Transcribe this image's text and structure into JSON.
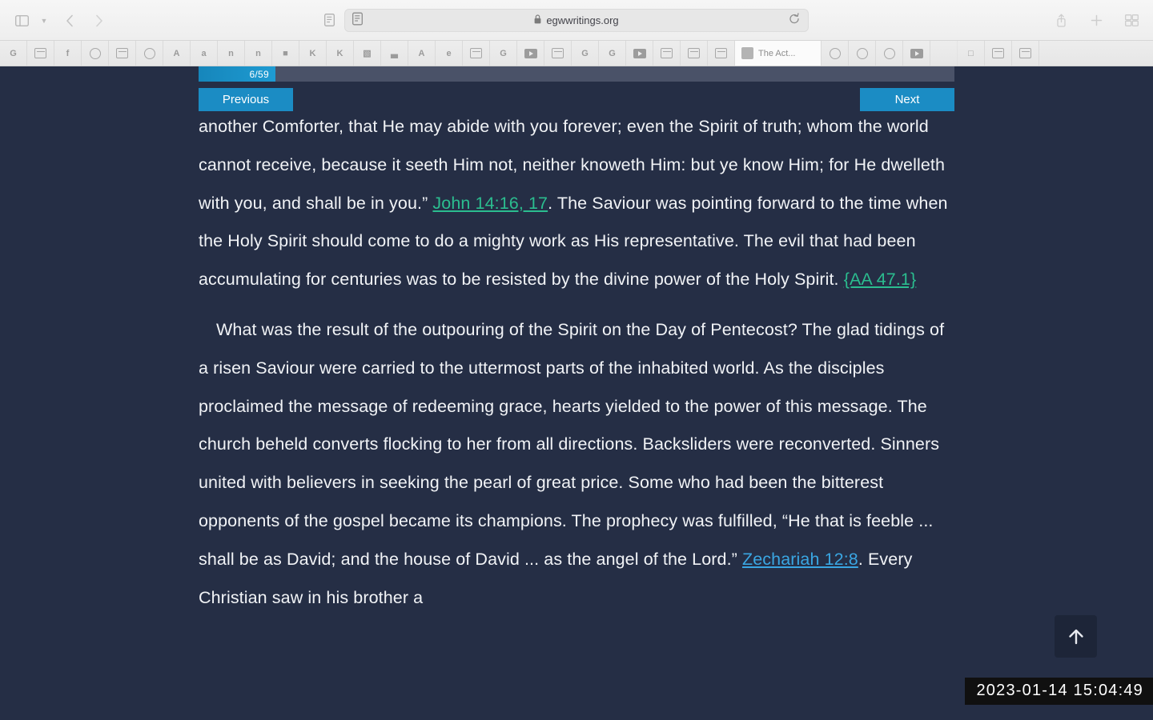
{
  "browser": {
    "url": "egwwritings.org",
    "lock_icon": "lock-icon",
    "reader_icon": "reader-view-icon",
    "reload_icon": "reload-icon",
    "sidebar_icon": "sidebar-toggle-icon",
    "back_icon": "back-arrow-icon",
    "forward_icon": "forward-arrow-icon",
    "share_icon": "share-icon",
    "newtab_icon": "new-tab-icon",
    "taboverview_icon": "tab-overview-icon",
    "active_tab_label": "The Act...",
    "favicon_tabs": [
      {
        "glyph": "G",
        "kind": "letter"
      },
      {
        "glyph": "",
        "kind": "sq"
      },
      {
        "glyph": "f",
        "kind": "letter"
      },
      {
        "glyph": "",
        "kind": "circ"
      },
      {
        "glyph": "",
        "kind": "sq"
      },
      {
        "glyph": "",
        "kind": "circ"
      },
      {
        "glyph": "A",
        "kind": "letter"
      },
      {
        "glyph": "a",
        "kind": "letter"
      },
      {
        "glyph": "n",
        "kind": "letter"
      },
      {
        "glyph": "n",
        "kind": "letter"
      },
      {
        "glyph": "■",
        "kind": "letter"
      },
      {
        "glyph": "K",
        "kind": "letter"
      },
      {
        "glyph": "K",
        "kind": "letter"
      },
      {
        "glyph": "▧",
        "kind": "letter"
      },
      {
        "glyph": "▃",
        "kind": "letter"
      },
      {
        "glyph": "A",
        "kind": "letter"
      },
      {
        "glyph": "e",
        "kind": "letter"
      },
      {
        "glyph": "",
        "kind": "sq"
      },
      {
        "glyph": "G",
        "kind": "letter"
      },
      {
        "glyph": "",
        "kind": "play"
      },
      {
        "glyph": "",
        "kind": "sq"
      },
      {
        "glyph": "G",
        "kind": "letter"
      },
      {
        "glyph": "G",
        "kind": "letter"
      },
      {
        "glyph": "",
        "kind": "play"
      },
      {
        "glyph": "",
        "kind": "sq"
      },
      {
        "glyph": "",
        "kind": "sq"
      },
      {
        "glyph": "",
        "kind": "sq"
      }
    ],
    "favicon_tabs_right": [
      {
        "glyph": "Ⓐ",
        "kind": "circ"
      },
      {
        "glyph": "Ⓐ",
        "kind": "circ"
      },
      {
        "glyph": "Ⓐ",
        "kind": "circ"
      },
      {
        "glyph": "",
        "kind": "play"
      },
      {
        "glyph": "",
        "kind": "dim"
      },
      {
        "glyph": "□",
        "kind": "letter"
      },
      {
        "glyph": "",
        "kind": "sq"
      },
      {
        "glyph": "",
        "kind": "sq"
      }
    ]
  },
  "reader": {
    "progress_label": "6/59",
    "progress_current": 6,
    "progress_total": 59,
    "previous_label": "Previous",
    "next_label": "Next",
    "scroll_top_icon": "arrow-up-icon"
  },
  "content": {
    "paragraph1": {
      "clipped_line": "another Comforter, that He may abide with you forever; even the Spirit of truth;",
      "text_a": "whom the world cannot receive, because it seeth Him not, neither knoweth Him: but ye know Him; for He dwelleth with you, and shall be in you.” ",
      "reference": "John 14:16, 17",
      "text_b": ". The Saviour was pointing forward to the time when the Holy Spirit should come to do a mighty work as His representative. The evil that had been accumulating for centuries was to be resisted by the divine power of the Holy Spirit. ",
      "citation": "{AA 47.1}"
    },
    "paragraph2": {
      "text_a": "What was the result of the outpouring of the Spirit on the Day of Pentecost? The glad tidings of a risen Saviour were carried to the uttermost parts of the inhabited world. As the disciples proclaimed the message of redeeming grace, hearts yielded to the power of this message. The church beheld converts flocking to her from all directions. Backsliders were reconverted. Sinners united with believers in seeking the pearl of great price. Some who had been the bitterest opponents of the gospel became its champions. The prophecy was fulfilled, “He that is feeble ... shall be as David; and the house of David ... as the angel of the Lord.” ",
      "reference": "Zechariah 12:8",
      "text_b": ". Every Christian saw in his brother a"
    }
  },
  "overlay": {
    "timestamp": "2023-01-14 15:04:49"
  },
  "colors": {
    "page_background": "#252e45",
    "accent_blue": "#1b8cc4",
    "reference_teal": "#2bbd8f",
    "reference_blue": "#3aa6e2",
    "progress_track": "#4a5268"
  }
}
